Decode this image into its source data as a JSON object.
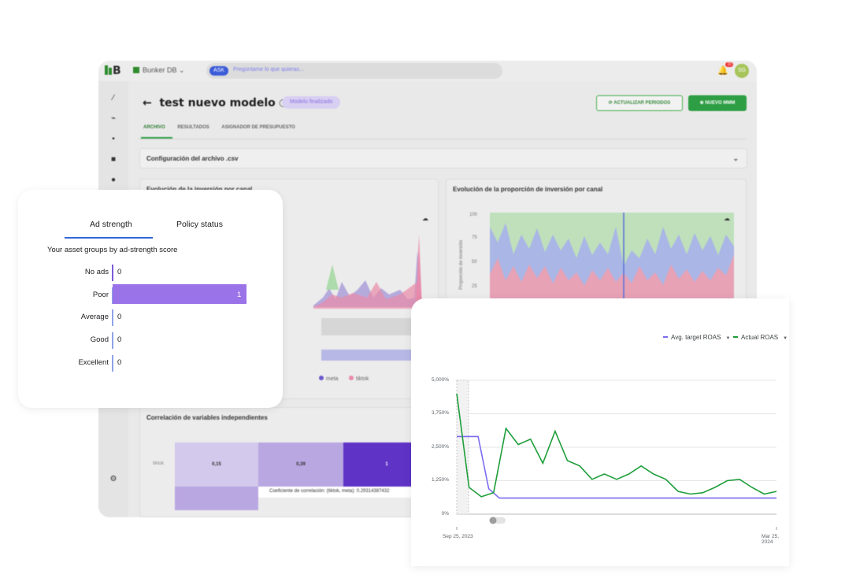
{
  "app": {
    "logo": "B",
    "project": "Bunker DB",
    "ask_pill": "ASK",
    "ask_placeholder": "Pregúntame lo que quieras...",
    "notifications": "10",
    "avatar_initials": "SG",
    "title": "test nuevo modelo",
    "status_chip": "Modelo finalizado",
    "btn_refresh": "ACTUALIZAR PERIODOS",
    "btn_new": "NUEVO MMM",
    "tabs": [
      "ARCHIVO",
      "RESULTADOS",
      "ASIGNADOR DE PRESUPUESTO"
    ],
    "csv_section": "Configuración del archivo .csv",
    "panel_left_title": "Evolución de la inversión por canal",
    "panel_right_title": "Evolución de la proporción de inversión por canal",
    "panel_right_ylabel": "Proporción de inversión",
    "panel_right_yticks": [
      "100",
      "75",
      "50",
      "25"
    ],
    "legend_meta": "meta",
    "legend_tiktok": "tiktok",
    "corr_title": "Correlación de variables independientes",
    "corr_row": "tiktok",
    "corr_values": [
      "0,15",
      "0,39",
      "1"
    ],
    "corr_tooltip": "Coeficiente de correlación: (tiktok, meta): 0.29314387432"
  },
  "ad_strength": {
    "tabs": [
      "Ad strength",
      "Policy status"
    ],
    "subtitle": "Your asset groups by ad-strength score",
    "rows": [
      {
        "label": "No ads",
        "value": 0
      },
      {
        "label": "Poor",
        "value": 1
      },
      {
        "label": "Average",
        "value": 0
      },
      {
        "label": "Good",
        "value": 0
      },
      {
        "label": "Excellent",
        "value": 0
      }
    ],
    "colors": {
      "bar": "#9a73e8",
      "axis_no_ads": "#7b5bd8",
      "axis_other": "#8fa3e8"
    }
  },
  "roas": {
    "legend": [
      {
        "name": "Avg. target ROAS",
        "color": "#7b6cf0"
      },
      {
        "name": "Actual ROAS",
        "color": "#1e9e3a"
      }
    ],
    "x_start": "Sep 25, 2023",
    "x_end": "Mar 25, 2024",
    "y_ticks": [
      "5,000%",
      "3,750%",
      "2,500%",
      "1,250%",
      "0%"
    ]
  },
  "chart_data": {
    "type": "line",
    "title": "",
    "xlabel": "",
    "ylabel": "",
    "ylim": [
      0,
      5000
    ],
    "x_range": [
      "Sep 25, 2023",
      "Mar 25, 2024"
    ],
    "grid": true,
    "legend_position": "top-right",
    "series": [
      {
        "name": "Avg. target ROAS",
        "values": [
          2900,
          2900,
          2900,
          950,
          600,
          600,
          600,
          600,
          600,
          600,
          600,
          600,
          600,
          600,
          600,
          600,
          600,
          600,
          600,
          600,
          600,
          600,
          600,
          600,
          600,
          600,
          600,
          600,
          600,
          600,
          600
        ]
      },
      {
        "name": "Actual ROAS",
        "values": [
          4500,
          1000,
          650,
          800,
          3200,
          2600,
          2800,
          1900,
          3100,
          2000,
          1800,
          1300,
          1500,
          1300,
          1500,
          1800,
          1500,
          1300,
          850,
          750,
          800,
          1000,
          1250,
          1300,
          1000,
          750,
          850
        ]
      }
    ]
  }
}
